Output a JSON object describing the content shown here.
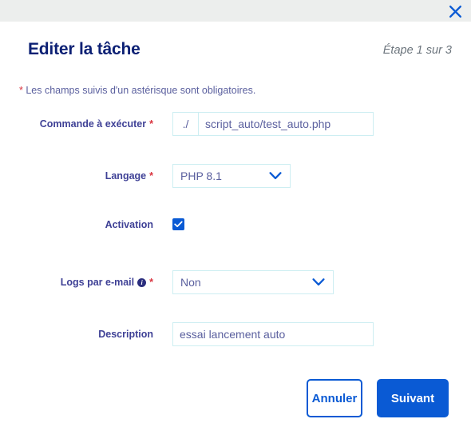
{
  "window": {
    "close_icon": "close-icon"
  },
  "dialog": {
    "title": "Editer la tâche",
    "step": "Étape 1 sur 3",
    "required_note_star": "*",
    "required_note": " Les champs suivis d'un astérisque sont obligatoires."
  },
  "fields": {
    "command": {
      "label": "Commande à exécuter",
      "required_marker": "*",
      "prefix": "./",
      "value": "script_auto/test_auto.php",
      "placeholder": ""
    },
    "language": {
      "label": "Langage",
      "required_marker": "*",
      "value": "PHP 8.1",
      "chevron_icon": "chevron-down-icon"
    },
    "activation": {
      "label": "Activation",
      "checked": true,
      "check_icon": "check-icon"
    },
    "email_logs": {
      "label": "Logs par e-mail",
      "info_icon": "info-icon",
      "info_glyph": "i",
      "required_marker": "*",
      "value": "Non",
      "chevron_icon": "chevron-down-icon"
    },
    "description": {
      "label": "Description",
      "value": "essai lancement auto",
      "placeholder": ""
    }
  },
  "footer": {
    "cancel_label": "Annuler",
    "next_label": "Suivant"
  },
  "colors": {
    "accent_blue": "#0a5ad4",
    "title_navy": "#0c2074",
    "label_indigo": "#3f4196",
    "input_border": "#cdeef2",
    "required_red": "#d9343f",
    "topbar_gray": "#eceeed"
  }
}
